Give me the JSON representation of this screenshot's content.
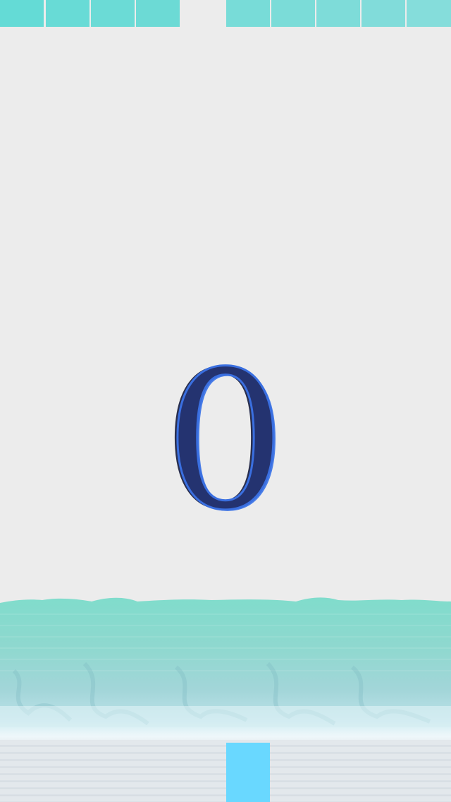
{
  "game": {
    "score": "0"
  },
  "colors": {
    "background": "#ececec",
    "top_blocks_left": "#66dbd6",
    "top_blocks_right": "#7fdcd8",
    "score_fill": "#243370",
    "score_outline": "#3a6fe0",
    "water_top": "#7fdcc9",
    "water_bottom": "#c6e8ee",
    "player_block": "#69d8ff"
  }
}
